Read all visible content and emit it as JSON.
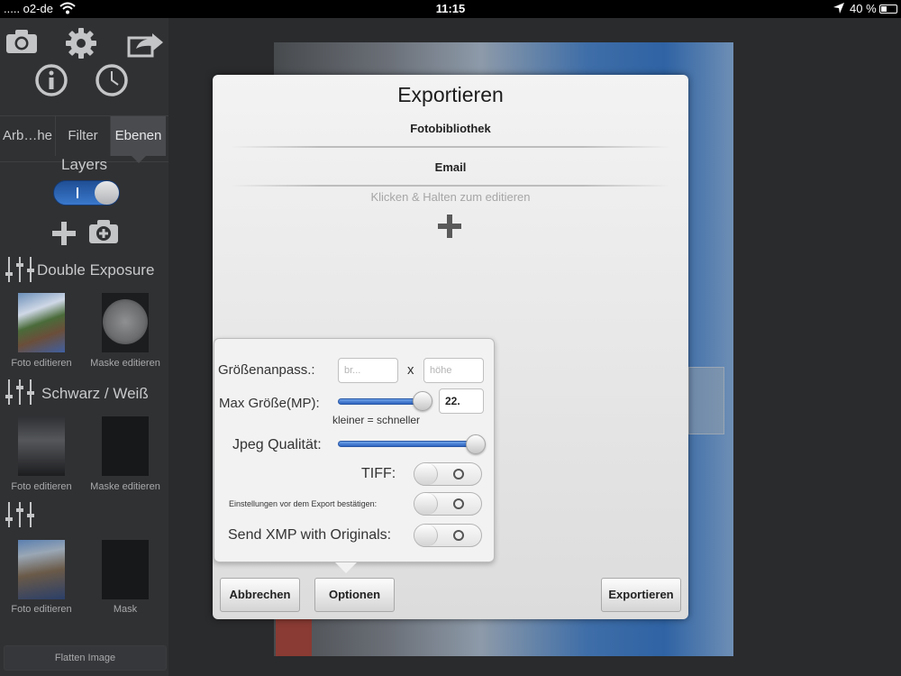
{
  "status_bar": {
    "carrier": "..... o2-de",
    "time": "11:15",
    "battery": "40 %",
    "battery_level": 0.4
  },
  "sidebar": {
    "toolbar_icons": [
      "camera-icon",
      "gear-icon",
      "export-share-icon",
      "info-icon",
      "clock-icon"
    ],
    "tabs": [
      {
        "label": "Arb…he",
        "selected": false
      },
      {
        "label": "Filter",
        "selected": false
      },
      {
        "label": "Ebenen",
        "selected": true
      }
    ],
    "layers_title": "Layers",
    "layers_toggle_on": true,
    "layers_toggle_text": "I",
    "layers": [
      {
        "title": "Double Exposure",
        "photo_label": "Foto editieren",
        "mask_label": "Maske editieren"
      },
      {
        "title": "Schwarz / Weiß",
        "photo_label": "Foto editieren",
        "mask_label": "Maske editieren"
      },
      {
        "title": "",
        "photo_label": "Foto editieren",
        "mask_label": "Mask"
      }
    ],
    "flatten_label": "Flatten Image"
  },
  "dialog": {
    "title": "Exportieren",
    "destinations": [
      "Fotobibliothek",
      "Email"
    ],
    "hint": "Klicken & Halten zum editieren",
    "cancel_label": "Abbrechen",
    "options_label": "Optionen",
    "export_label": "Exportieren"
  },
  "options": {
    "resize_label": "Größenanpass.:",
    "width_placeholder": "br...",
    "x_label": "x",
    "height_placeholder": "höhe",
    "max_size_label": "Max Größe(MP):",
    "max_size_value": "22.",
    "max_size_slider": 0.95,
    "max_size_hint": "kleiner = schneller",
    "jpeg_label": "Jpeg Qualität:",
    "jpeg_slider": 1.0,
    "tiff_label": "TIFF:",
    "tiff_on": false,
    "confirm_label": "Einstellungen vor dem Export bestätigen:",
    "confirm_on": false,
    "xmp_label": "Send XMP with Originals:",
    "xmp_on": false
  },
  "colors": {
    "accent_blue": "#2f6fd0",
    "sidebar_bg": "#303133"
  }
}
